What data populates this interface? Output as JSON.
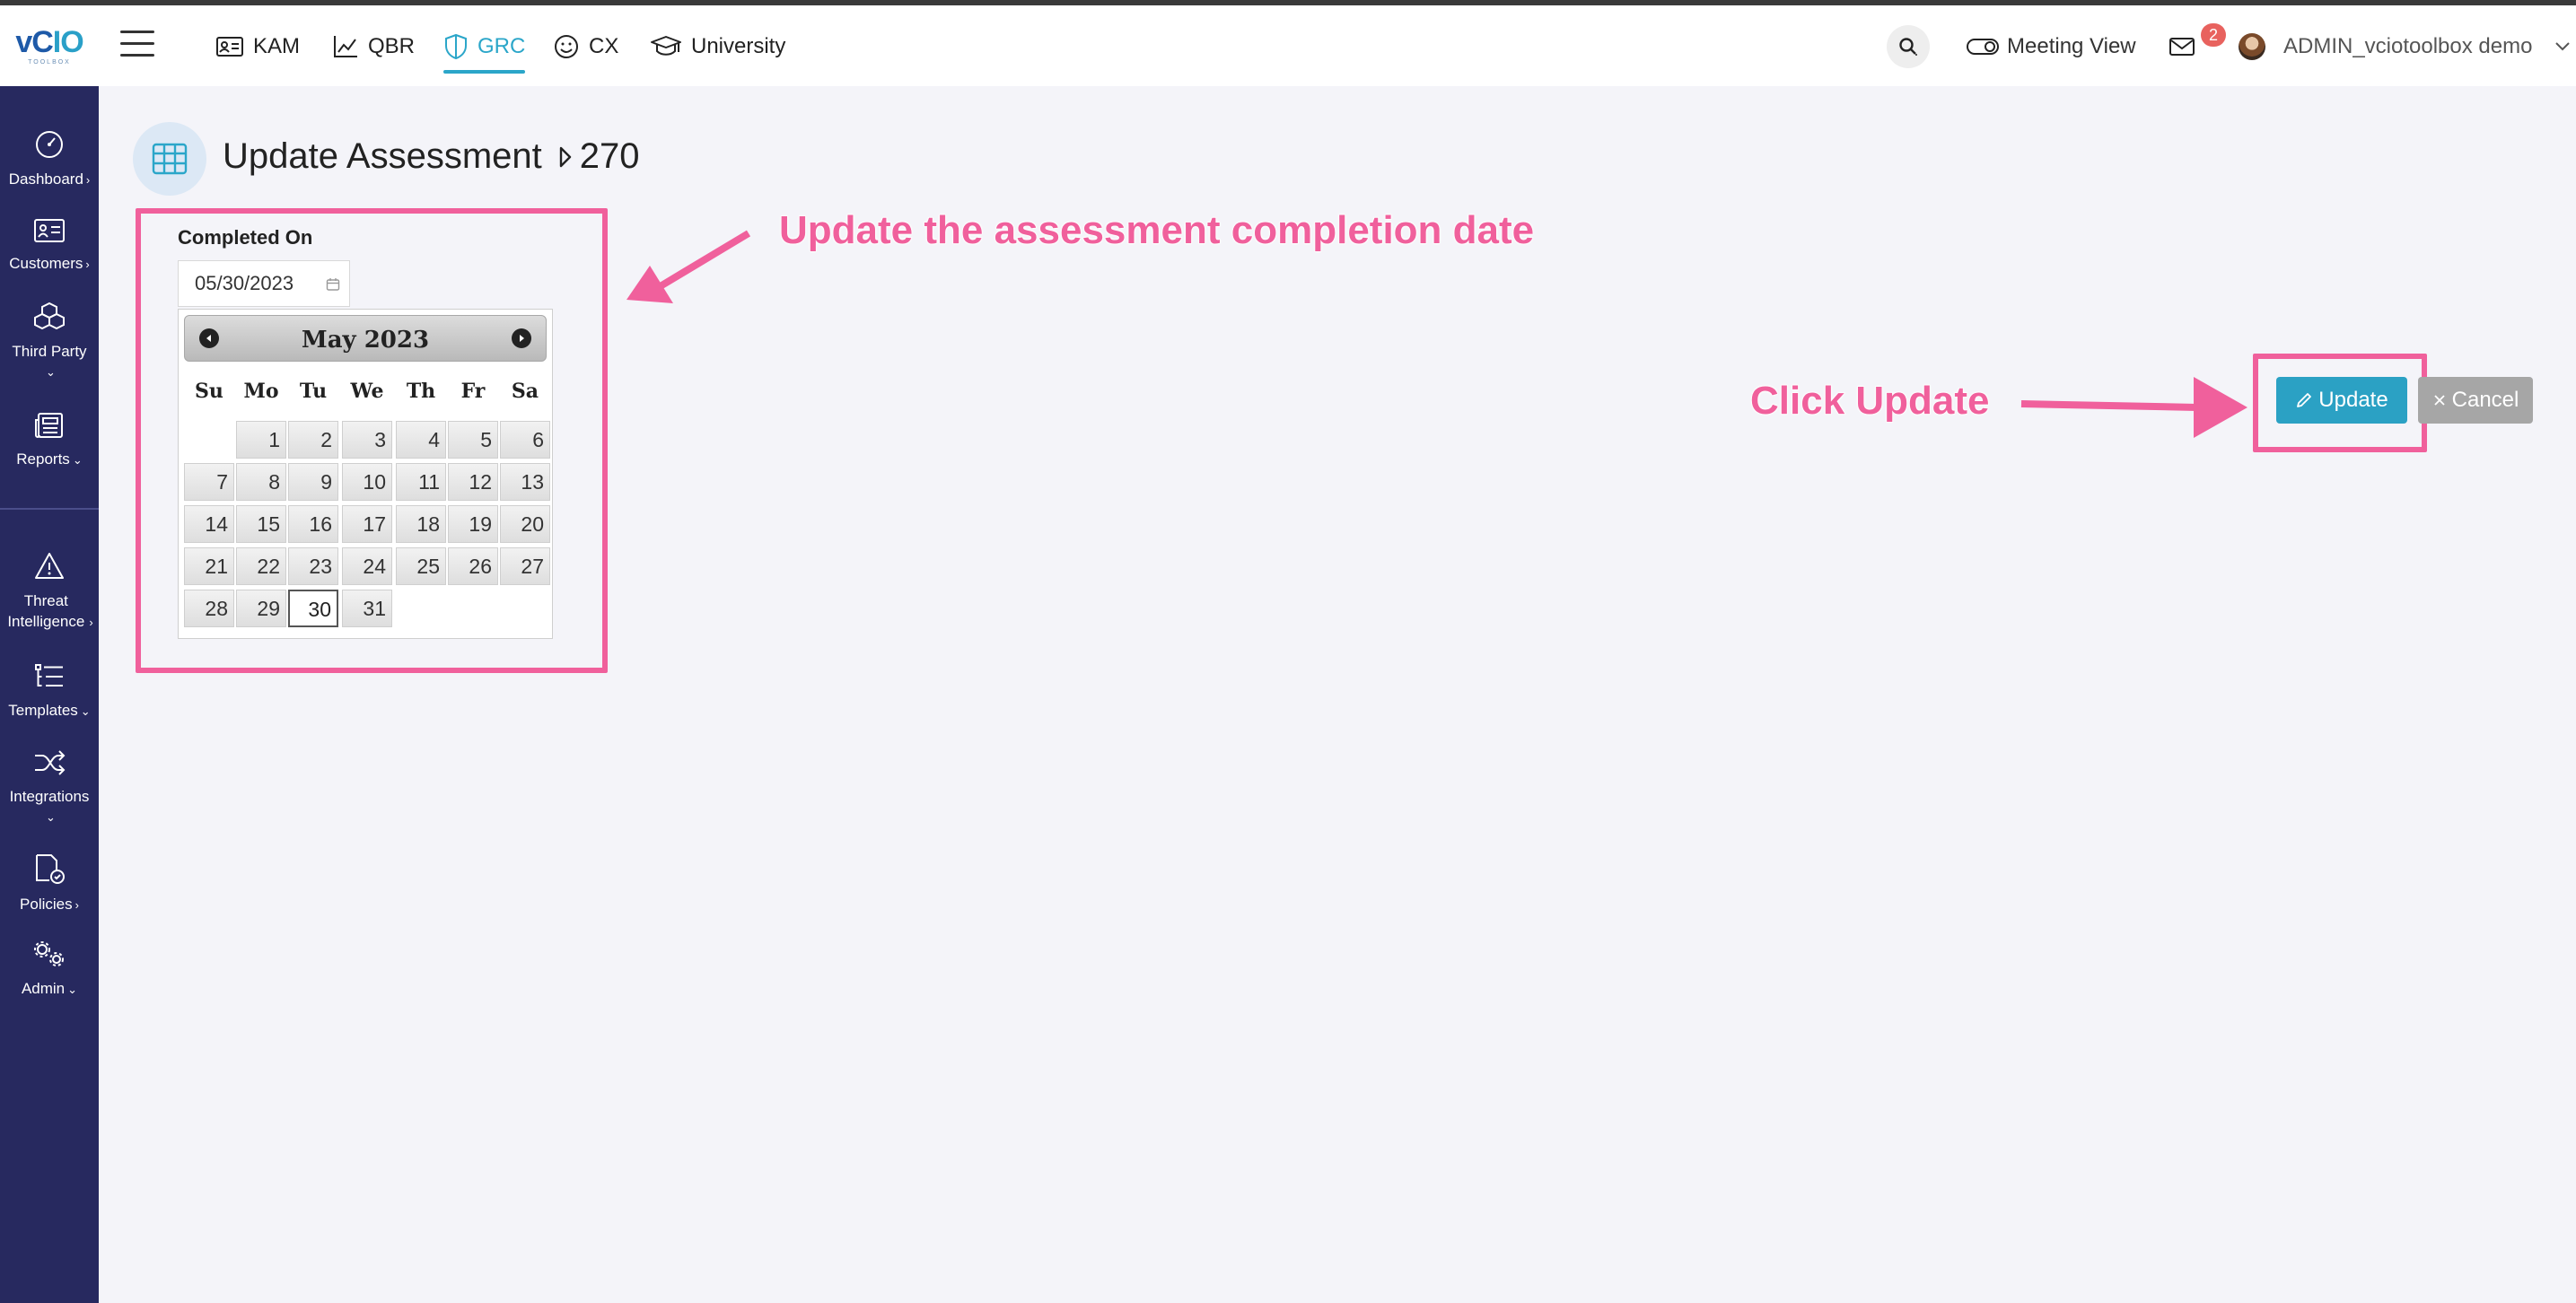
{
  "app": {
    "logo_text": "vCIO",
    "logo_subtext": "TOOLBOX"
  },
  "sidebar": {
    "items": [
      {
        "label": "Dashboard",
        "icon": "gauge-icon",
        "chevron": "›"
      },
      {
        "label": "Customers",
        "icon": "id-card-icon",
        "chevron": "›"
      },
      {
        "label": "Third Party",
        "icon": "cubes-icon",
        "chevron": "⌄"
      },
      {
        "label": "Reports",
        "icon": "newspaper-icon",
        "chevron": "⌄"
      },
      {
        "label": "Threat Intelligence",
        "icon": "warning-triangle-icon",
        "chevron": "›"
      },
      {
        "label": "Templates",
        "icon": "list-tree-icon",
        "chevron": "⌄"
      },
      {
        "label": "Integrations",
        "icon": "shuffle-icon",
        "chevron": "⌄"
      },
      {
        "label": "Policies",
        "icon": "policy-doc-icon",
        "chevron": "›"
      },
      {
        "label": "Admin",
        "icon": "gears-icon",
        "chevron": "⌄"
      }
    ]
  },
  "header": {
    "tabs": [
      {
        "label": "KAM",
        "icon": "id-card-icon"
      },
      {
        "label": "QBR",
        "icon": "line-chart-icon"
      },
      {
        "label": "GRC",
        "icon": "shield-icon",
        "active": true
      },
      {
        "label": "CX",
        "icon": "smiley-icon"
      },
      {
        "label": "University",
        "icon": "graduation-cap-icon"
      }
    ],
    "meeting_view_label": "Meeting View",
    "notification_count": "2",
    "user_name": "ADMIN_vciotoolbox demo"
  },
  "page": {
    "title": "Update Assessment",
    "record_id": "270"
  },
  "form": {
    "completed_on_label": "Completed On",
    "completed_on_value": "05/30/2023"
  },
  "datepicker": {
    "month_title": "May 2023",
    "weekdays": [
      "Su",
      "Mo",
      "Tu",
      "We",
      "Th",
      "Fr",
      "Sa"
    ],
    "first_weekday_index": 1,
    "days_in_month": 31,
    "selected_day": 30
  },
  "buttons": {
    "update_label": "Update",
    "cancel_label": "Cancel"
  },
  "annotations": {
    "date_hint": "Update the assessment completion date",
    "update_hint": "Click Update",
    "color": "#f0609c"
  },
  "colors": {
    "sidebar_bg": "#27295f",
    "accent": "#2ba6c9",
    "cancel_bg": "#a6a6a6"
  }
}
